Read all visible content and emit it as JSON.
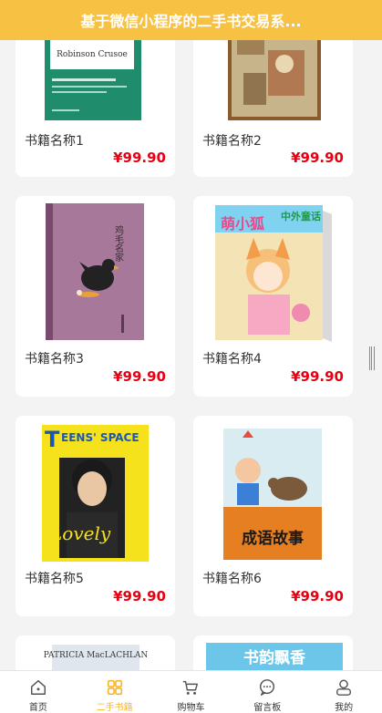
{
  "header": {
    "title": "基于微信小程序的二手书交易系..."
  },
  "books": [
    {
      "name": "书籍名称1",
      "price": "¥99.90",
      "cover_icon": "book-cover-green"
    },
    {
      "name": "书籍名称2",
      "price": "¥99.90",
      "cover_icon": "book-cover-painting"
    },
    {
      "name": "书籍名称3",
      "price": "¥99.90",
      "cover_icon": "book-cover-purple-hen"
    },
    {
      "name": "书籍名称4",
      "price": "¥99.90",
      "cover_icon": "book-cover-fairy-tales"
    },
    {
      "name": "书籍名称5",
      "price": "¥99.90",
      "cover_icon": "magazine-cover-teens"
    },
    {
      "name": "书籍名称6",
      "price": "¥99.90",
      "cover_icon": "book-cover-idiom-stories"
    },
    {
      "cover_icon": "book-cover-partial-left"
    },
    {
      "cover_icon": "book-cover-partial-right"
    }
  ],
  "cover_text": {
    "book1_title": "Robinson Crusoe",
    "book3_title": "鸡毛名家",
    "book4_title_a": "萌小狐",
    "book4_title_b": "中外童话",
    "book5_brand": "EENS' SPACE",
    "book5_letter": "T",
    "book5_word": "Lovely",
    "book6_title": "成语故事",
    "book7_author": "PATRICIA MacLACHLAN",
    "book8_title": "书韵飘香"
  },
  "tabbar": {
    "active_color": "#f7b52c",
    "items": [
      {
        "label": "首页",
        "icon": "home-icon",
        "active": false
      },
      {
        "label": "二手书籍",
        "icon": "grid-icon",
        "active": true
      },
      {
        "label": "购物车",
        "icon": "cart-icon",
        "active": false
      },
      {
        "label": "留言板",
        "icon": "message-icon",
        "active": false
      },
      {
        "label": "我的",
        "icon": "user-icon",
        "active": false
      }
    ]
  },
  "colors": {
    "header_bg": "#f7c244",
    "price": "#e60012"
  }
}
